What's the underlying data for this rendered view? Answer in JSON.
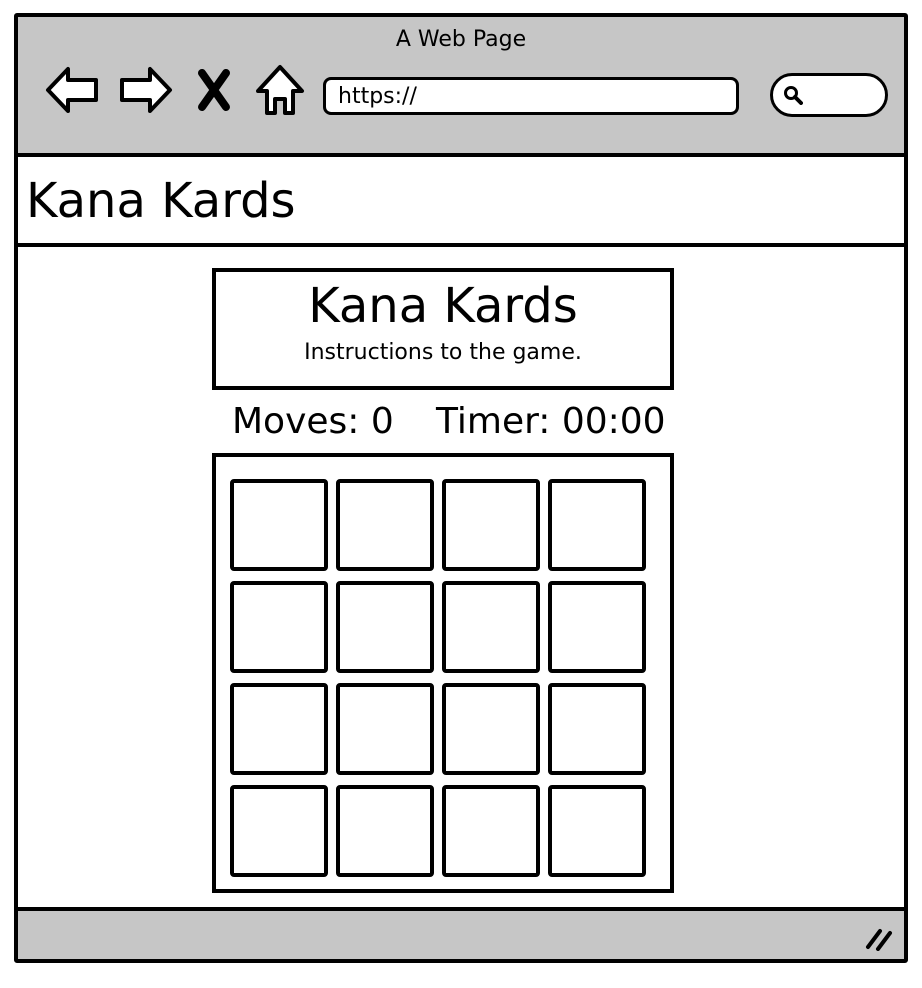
{
  "window": {
    "title": "A Web Page"
  },
  "browser": {
    "nav_icons": [
      "back-arrow-icon",
      "forward-arrow-icon",
      "close-icon",
      "home-icon"
    ],
    "url": "https://",
    "search_icon": "search-icon"
  },
  "header": {
    "title": "Kana Kards"
  },
  "game": {
    "title": "Kana Kards",
    "instructions": "Instructions to the game.",
    "moves": "Moves: 0",
    "timer": "Timer: 00:00",
    "grid": {
      "rows": 4,
      "columns": 4
    }
  },
  "status_bar": {
    "grip_icon": "resize-grip-icon"
  }
}
